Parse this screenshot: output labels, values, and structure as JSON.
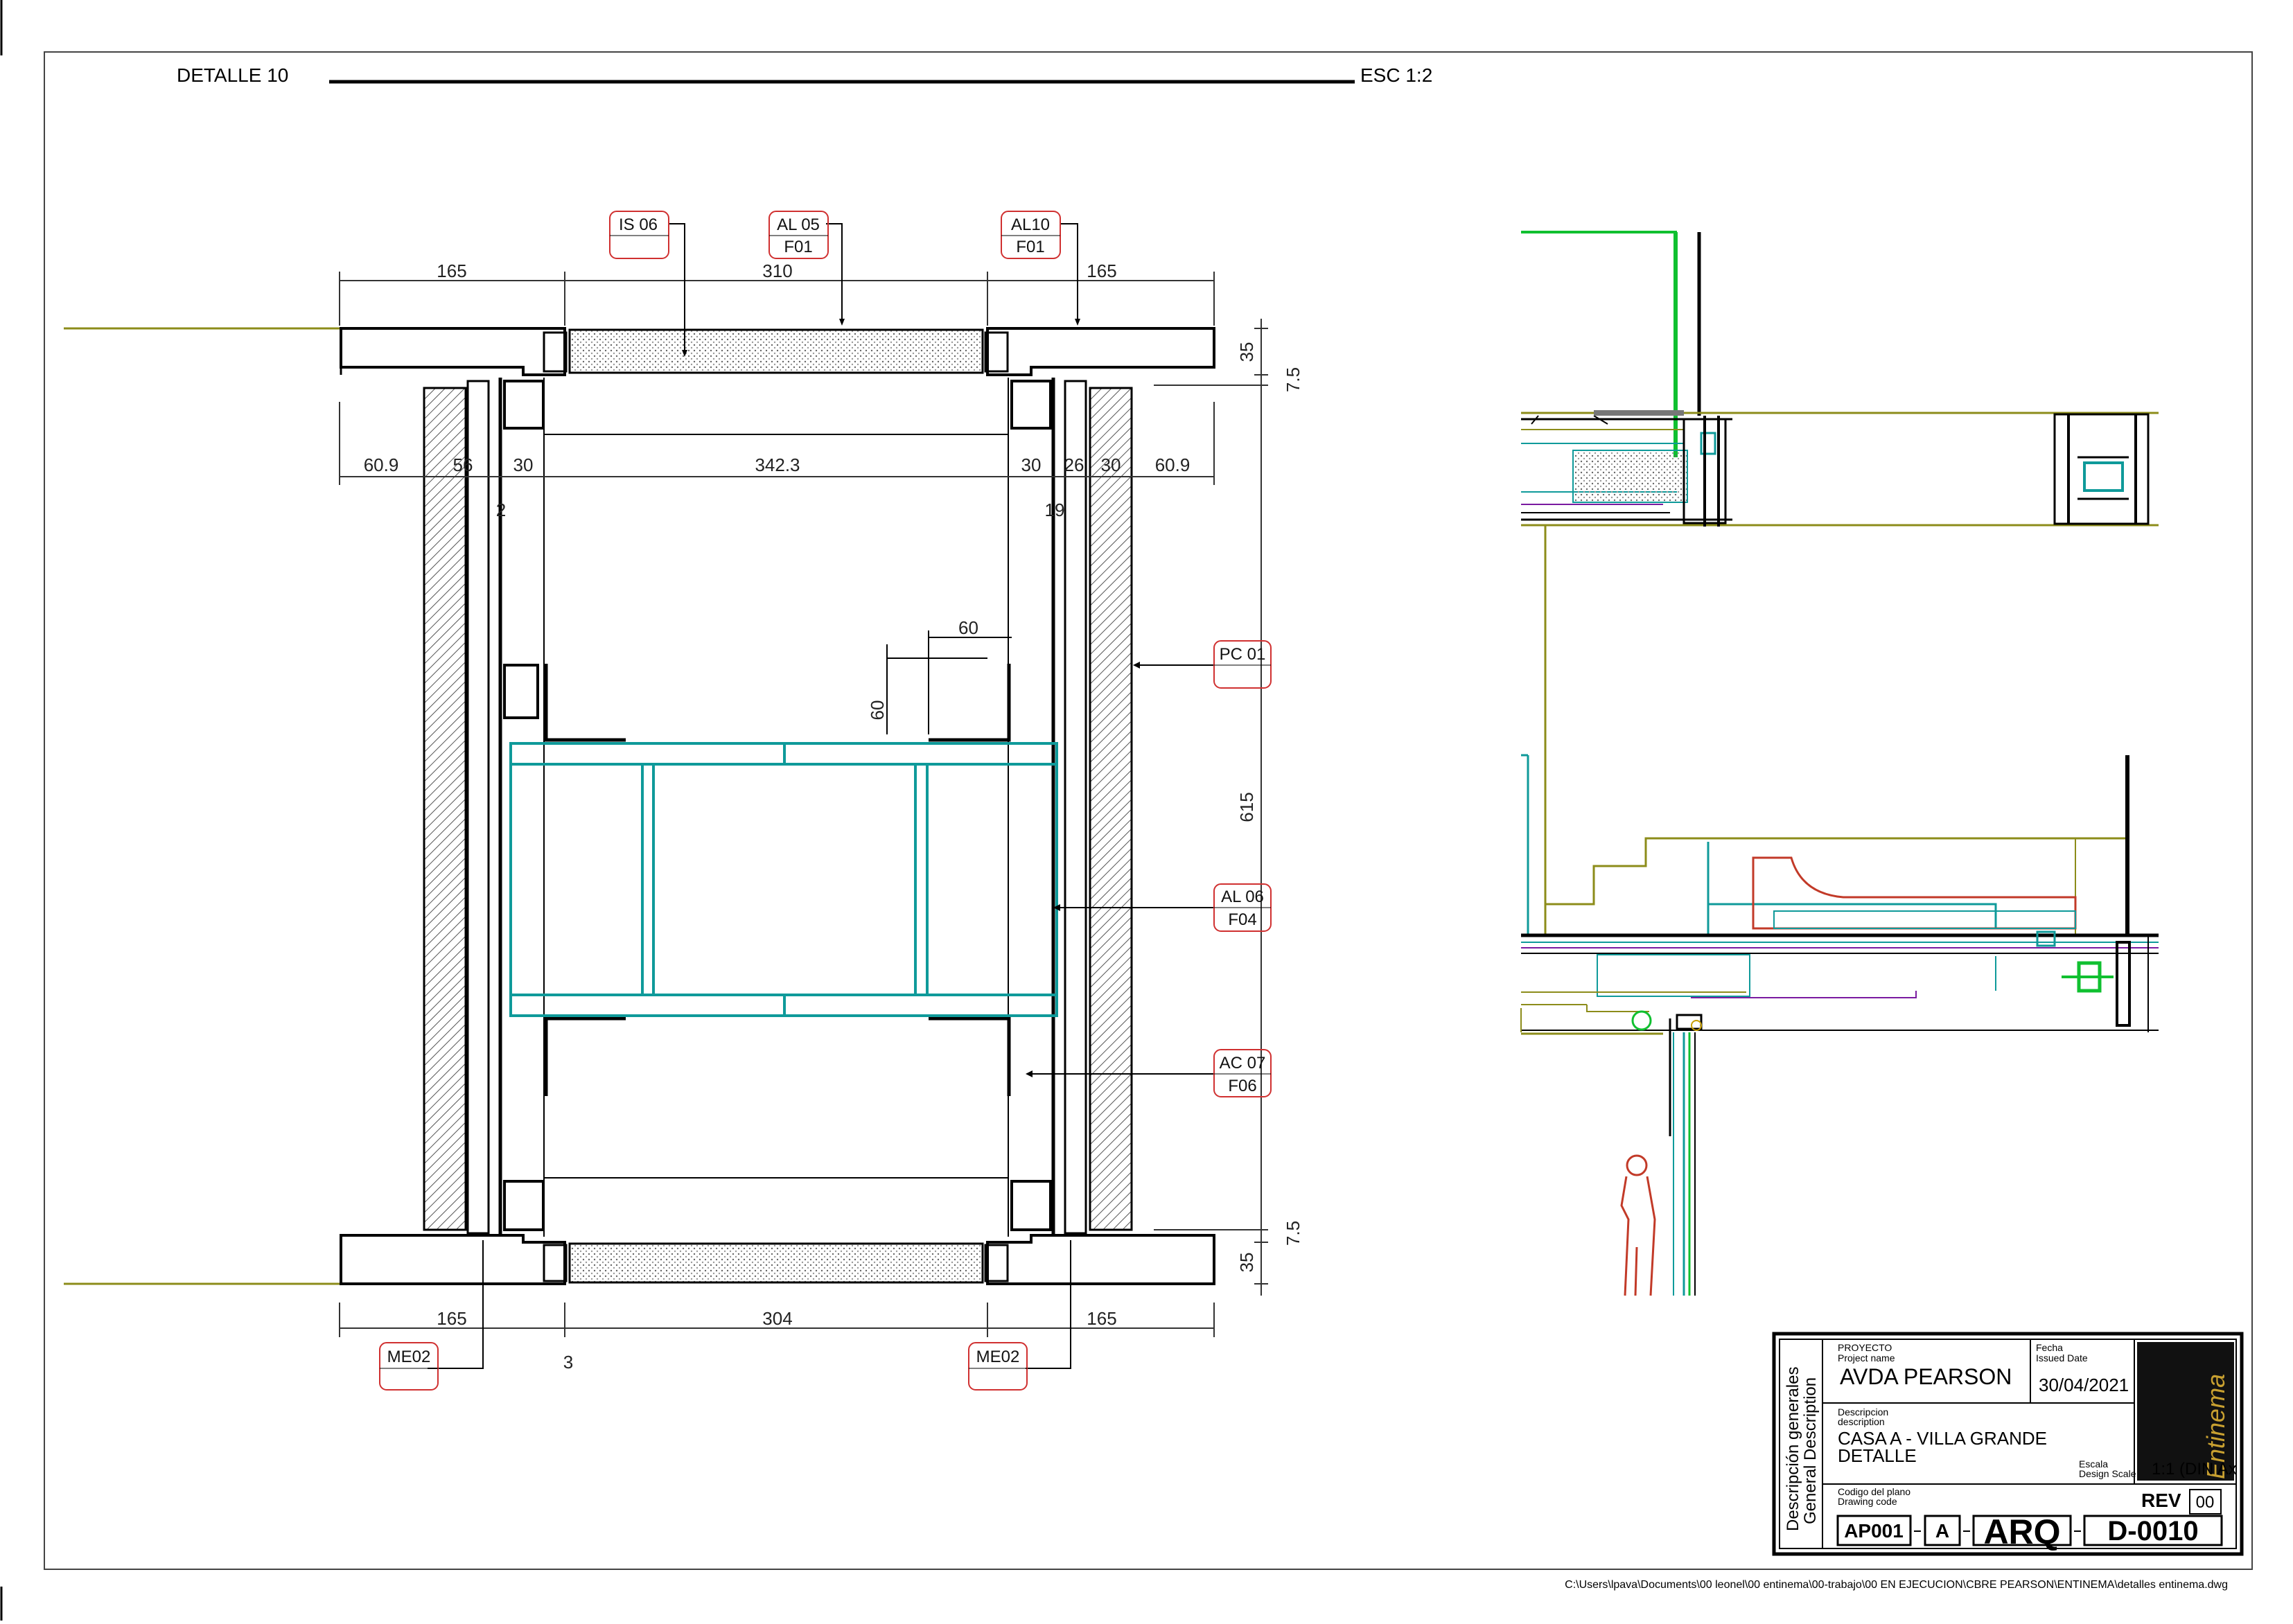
{
  "sheet": {
    "detail_title": "DETALLE 10",
    "scale_label": "ESC 1:2",
    "file_path": "C:\\Users\\lpava\\Documents\\00 leonel\\00 entinema\\00-trabajo\\00 EN EJECUCION\\CBRE PEARSON\\ENTINEMA\\detalles entinema.dwg"
  },
  "dimensions": {
    "top_165_left": "165",
    "top_310": "310",
    "top_165_right": "165",
    "right_35_top": "35",
    "right_7_5_top": "7.5",
    "row_60_9_left": "60.9",
    "row_56": "56",
    "row_30_a": "30",
    "row_342_3": "342.3",
    "row_30_b": "30",
    "row_26": "26",
    "row_30_c": "30",
    "row_60_9_right": "60.9",
    "small_2": "2",
    "small_19": "19",
    "dim_60_h": "60",
    "dim_60_v": "60",
    "right_615": "615",
    "right_7_5_bottom": "7.5",
    "right_35_bottom": "35",
    "bot_165_left": "165",
    "bot_304": "304",
    "bot_165_right": "165",
    "bot_3": "3"
  },
  "tags": {
    "is06": "IS 06",
    "al05": "AL 05",
    "al05_sub": "F01",
    "al10": "AL10",
    "al10_sub": "F01",
    "pc01": "PC 01",
    "al06": "AL 06",
    "al06_sub": "F04",
    "ac07": "AC 07",
    "ac07_sub": "F06",
    "me02_left": "ME02",
    "me02_right": "ME02"
  },
  "title_block": {
    "side_label_1": "Descripción generales",
    "side_label_2": "General Description",
    "project_label_es": "PROYECTO",
    "project_label_en": "Project name",
    "project_name": "AVDA PEARSON",
    "date_label_es": "Fecha",
    "date_label_en": "Issued Date",
    "date": "30/04/2021",
    "desc_label_es": "Descripcion",
    "desc_label_en": "description",
    "desc_line_1": "CASA A -  VILLA GRANDE",
    "desc_line_2": "DETALLE",
    "scale_label_es": "Escala",
    "scale_label_en": "Design  Scale",
    "scale_value": "1:1 (DIN Ax",
    "code_label_es": "Codigo del plano",
    "code_label_en": "Drawing code",
    "rev_label": "REV",
    "rev_value": "00",
    "code_1": "AP001",
    "code_2": "A",
    "code_3": "ARQ",
    "code_4": "D-0010",
    "logo_text": "Entinema"
  },
  "colors": {
    "cyan": "#0f9a9a",
    "olive": "#8c8c1a",
    "green": "#10c030",
    "red": "#c23a28",
    "purple": "#7a1aa0",
    "tag_border": "#d03030"
  }
}
